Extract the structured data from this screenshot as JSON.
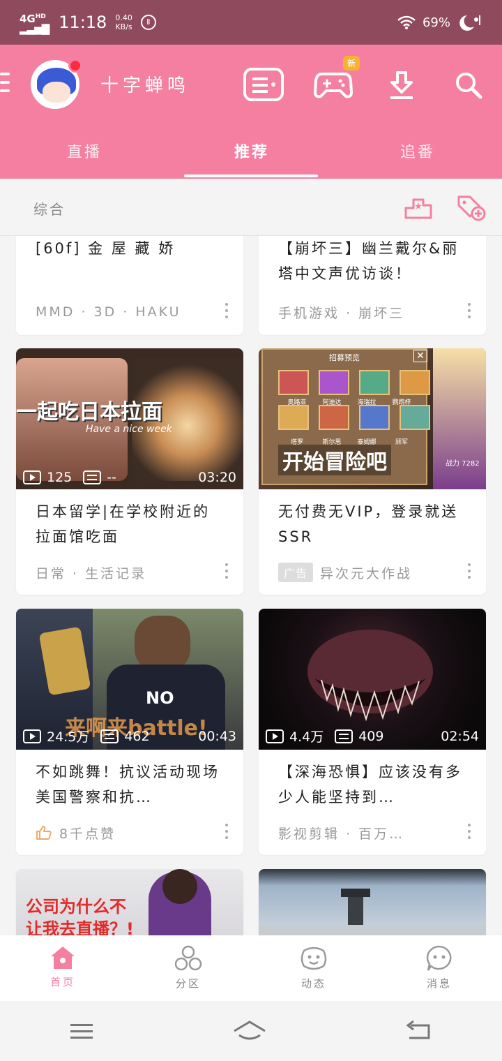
{
  "status": {
    "network": "4G",
    "network_sup": "HD",
    "time": "11:18",
    "speed_value": "0.40",
    "speed_unit": "KB/s",
    "battery": "69%"
  },
  "header": {
    "username": "十字蝉鸣",
    "game_badge": "新"
  },
  "tabs": [
    {
      "label": "直播"
    },
    {
      "label": "推荐"
    },
    {
      "label": "追番"
    }
  ],
  "subbar": {
    "label": "综合"
  },
  "cards": [
    {
      "title": "[60f] 金 屋 藏 娇",
      "meta": "MMD · 3D · HAKU"
    },
    {
      "title": "【崩坏三】幽兰戴尔&丽塔中文声优访谈！",
      "meta": "手机游戏 · 崩坏三"
    },
    {
      "title": "日本留学|在学校附近的拉面馆吃面",
      "meta": "日常 · 生活记录",
      "plays": "125",
      "danmaku": "--",
      "duration": "03:20",
      "overlay": "一起吃日本拉面",
      "overlay_sub": "Have a nice week"
    },
    {
      "title": "无付费无VIP，登录就送SSR",
      "meta": "异次元大作战",
      "ad_tag": "广告",
      "overlay": "开始冒险吧",
      "panel_title": "招募预览",
      "power": "战力 7282",
      "hero_names": [
        "奥路亚",
        "阿迪达",
        "海瑞拉",
        "鹦鹉梓",
        "塔罗",
        "斯尔思",
        "泰姆娜",
        "顾军"
      ]
    },
    {
      "title": "不如跳舞！抗议活动现场美国警察和抗…",
      "meta": "8千点赞",
      "plays": "24.5万",
      "danmaku": "462",
      "duration": "00:43",
      "overlay": "来啊来battle!",
      "shirt": "NO"
    },
    {
      "title": "【深海恐惧】应该没有多少人能坚持到…",
      "meta": "影视剪辑 · 百万…",
      "plays": "4.4万",
      "danmaku": "409",
      "duration": "02:54"
    },
    {
      "overlay": "公司为什么不让我去直播？!"
    },
    {}
  ],
  "bottom_nav": [
    {
      "label": "首页"
    },
    {
      "label": "分区"
    },
    {
      "label": "动态"
    },
    {
      "label": "消息"
    }
  ],
  "colors": {
    "brand_pink": "#f47fa1",
    "status_bar": "#8f4a5e",
    "badge_orange": "#f6b233"
  }
}
